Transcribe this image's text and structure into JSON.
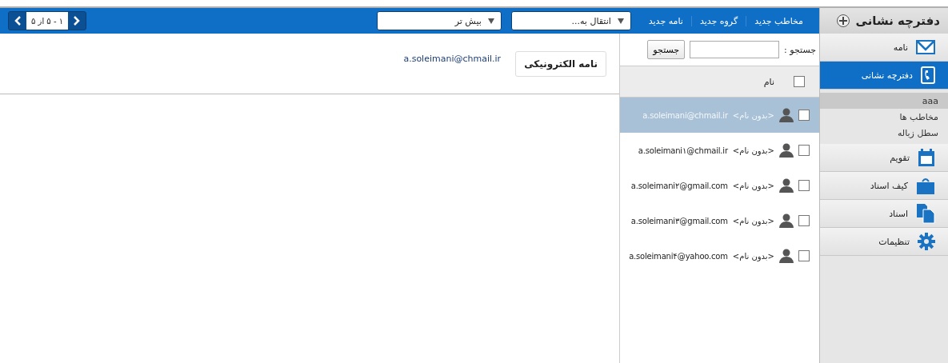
{
  "sidebar": {
    "title": "دفترچه نشانی",
    "items": [
      {
        "kind": "envelope",
        "label": "نامه",
        "selected": false
      },
      {
        "kind": "phone",
        "label": "دفترچه نشانی",
        "selected": true,
        "children": [
          {
            "label": "aaa",
            "selected": true
          },
          {
            "label": "مخاطب ها",
            "selected": false
          },
          {
            "label": "سطل زباله",
            "selected": false
          }
        ]
      },
      {
        "kind": "calendar",
        "label": "تقویم",
        "selected": false
      },
      {
        "kind": "briefcase",
        "label": "کیف اسناد",
        "selected": false
      },
      {
        "kind": "documents",
        "label": "اسناد",
        "selected": false
      },
      {
        "kind": "gear",
        "label": "تنظیمات",
        "selected": false
      }
    ]
  },
  "toolbar": {
    "links": [
      "مخاطب جدید",
      "گروه جدید",
      "نامه جدید"
    ],
    "dropdowns": [
      "انتقال به...",
      "بیش تر"
    ],
    "pager": "۱ - ۵ از ۵"
  },
  "search": {
    "label": "جستجو :",
    "button": "جستجو"
  },
  "contacts": {
    "header": {
      "label": "نام",
      "checked": false
    },
    "rows": [
      {
        "name": "<بدون نام>",
        "email": "a.soleimani@chmail.ir",
        "checked": false,
        "selected": true
      },
      {
        "name": "<بدون نام>",
        "email": "a.soleimani۱@chmail.ir",
        "checked": false,
        "selected": false
      },
      {
        "name": "<بدون نام>",
        "email": "a.soleimani۲@gmail.com",
        "checked": false,
        "selected": false
      },
      {
        "name": "<بدون نام>",
        "email": "a.soleimani۳@gmail.com",
        "checked": false,
        "selected": false
      },
      {
        "name": "<بدون نام>",
        "email": "a.soleimani۴@yahoo.com",
        "checked": false,
        "selected": false
      }
    ]
  },
  "detail": {
    "fields": [
      {
        "label": "نامه الکترونیکی",
        "value": "a.soleimani@chmail.ir"
      }
    ]
  }
}
